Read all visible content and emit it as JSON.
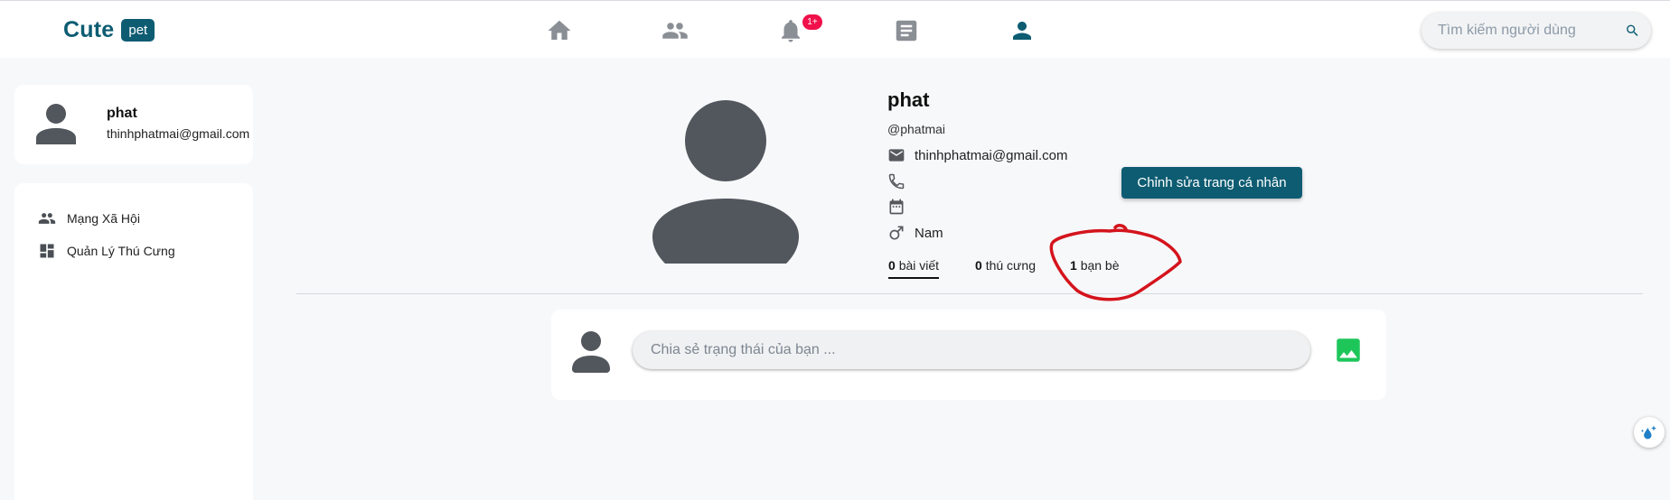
{
  "navbar": {
    "logo_text": "Cute",
    "logo_badge": "pet",
    "nav_icons": [
      "home-icon",
      "friends-icon",
      "bell-icon",
      "posts-icon",
      "profile-icon"
    ],
    "notification_badge": "1+",
    "search_placeholder": "Tìm kiếm người dùng"
  },
  "sidebar": {
    "user": {
      "name": "phat",
      "email": "thinhphatmai@gmail.com"
    },
    "menu": [
      {
        "label": "Mạng Xã Hội",
        "icon": "people-icon"
      },
      {
        "label": "Quản Lý Thú Cưng",
        "icon": "dashboard-icon"
      }
    ]
  },
  "profile": {
    "name": "phat",
    "handle": "@phatmai",
    "email": "thinhphatmai@gmail.com",
    "phone": "",
    "birthday": "",
    "gender": "Nam",
    "edit_button": "Chỉnh sửa trang cá nhân",
    "stats": [
      {
        "count": "0",
        "label": "bài viết"
      },
      {
        "count": "0",
        "label": "thú cưng"
      },
      {
        "count": "1",
        "label": "bạn bè"
      }
    ]
  },
  "composer": {
    "placeholder": "Chia sẻ trạng thái của bạn ..."
  },
  "colors": {
    "brand": "#0d5c72",
    "badge": "#f0104a",
    "image_button": "#1ec65a",
    "annotation": "#d4141c"
  }
}
